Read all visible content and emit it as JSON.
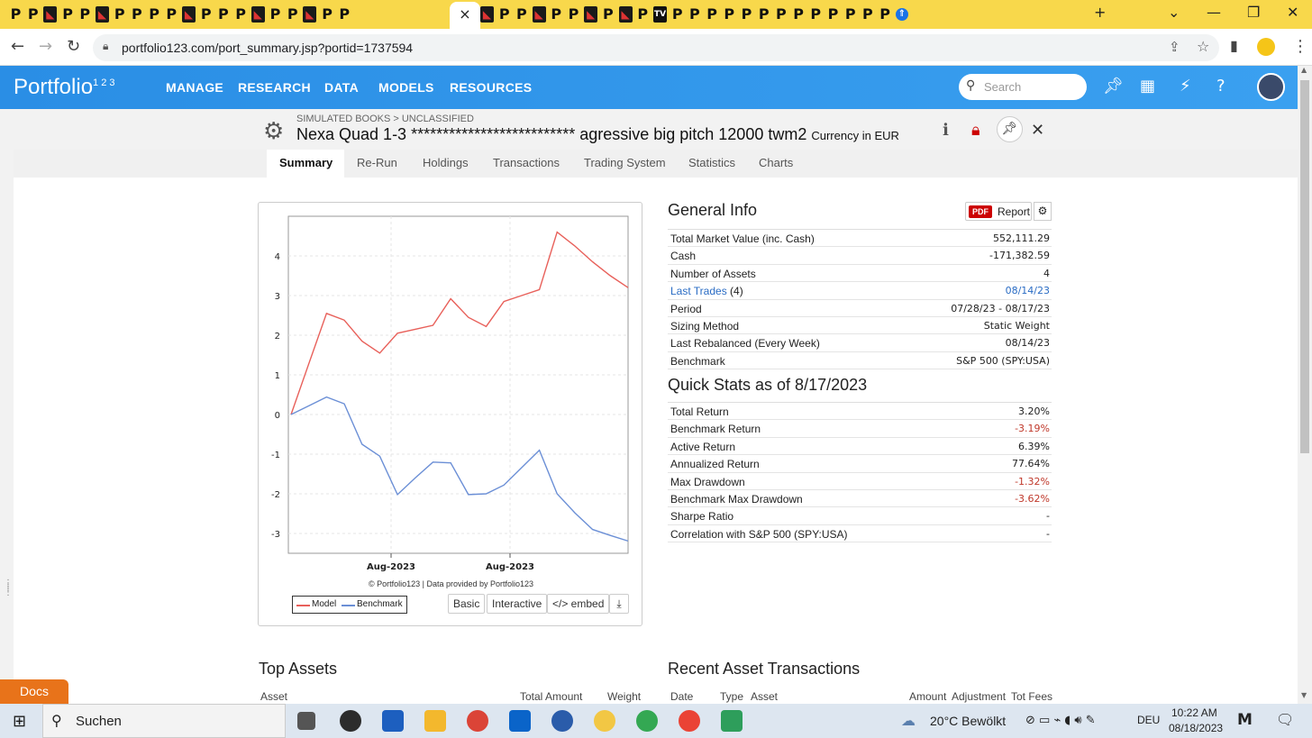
{
  "browser": {
    "url": "portfolio123.com/port_summary.jsp?portid=1737594",
    "active_tab_close": "×",
    "new_tab": "+"
  },
  "site": {
    "logo_text": "Portfolio",
    "logo_sup": "1 2 3",
    "nav": [
      "MANAGE",
      "RESEARCH",
      "DATA",
      "MODELS",
      "RESOURCES"
    ],
    "search_placeholder": "Search"
  },
  "page": {
    "breadcrumb": "SIMULATED BOOKS > UNCLASSIFIED",
    "title": "Nexa Quad 1-3 ************************** agressive big pitch 12000 twm2",
    "currency": "Currency in EUR",
    "tabs": [
      "Summary",
      "Re-Run",
      "Holdings",
      "Transactions",
      "Trading System",
      "Statistics",
      "Charts"
    ],
    "active_tab": "Summary"
  },
  "chart_controls": {
    "copyright": "© Portfolio123 | Data provided by Portfolio123",
    "basic": "Basic",
    "interactive": "Interactive",
    "embed": "</> embed"
  },
  "chart_data": {
    "type": "line",
    "x_tick_labels": [
      "Aug-2023",
      "Aug-2023"
    ],
    "ylim": [
      -3.5,
      5
    ],
    "y_ticks": [
      4,
      3,
      2,
      1,
      0,
      -1,
      -2,
      -3
    ],
    "grid": true,
    "legend_placement": "bottom-left",
    "series": [
      {
        "name": "Model",
        "color": "#e8605a",
        "x": [
          0,
          1,
          2,
          3,
          4,
          5,
          6,
          7,
          8,
          9,
          10,
          11,
          12,
          13,
          14,
          15,
          16,
          17,
          18,
          19
        ],
        "values": [
          0.0,
          1.28,
          2.55,
          2.38,
          1.85,
          1.55,
          2.05,
          2.15,
          2.25,
          2.92,
          2.45,
          2.22,
          2.85,
          3.0,
          3.15,
          4.6,
          4.25,
          3.85,
          3.5,
          3.2
        ]
      },
      {
        "name": "Benchmark",
        "color": "#6b8fd6",
        "x": [
          0,
          1,
          2,
          3,
          4,
          5,
          6,
          7,
          8,
          9,
          10,
          11,
          12,
          13,
          14,
          15,
          16,
          17,
          18,
          19
        ],
        "values": [
          0.0,
          0.22,
          0.44,
          0.27,
          -0.75,
          -1.05,
          -2.02,
          -1.6,
          -1.2,
          -1.22,
          -2.02,
          -2.0,
          -1.78,
          -1.34,
          -0.9,
          -2.0,
          -2.48,
          -2.9,
          -3.05,
          -3.19
        ]
      }
    ]
  },
  "general_info": {
    "title": "General Info",
    "report_badge": "PDF",
    "report_label": "Report",
    "rows": [
      {
        "k": "Total Market Value (inc. Cash)",
        "v": "552,111.29"
      },
      {
        "k": "Cash",
        "v": "-171,382.59"
      },
      {
        "k": "Number of Assets",
        "v": "4"
      },
      {
        "k": "Last Trades",
        "k2": "(4)",
        "v": "08/14/23"
      },
      {
        "k": "Period",
        "v": "07/28/23 - 08/17/23"
      },
      {
        "k": "Sizing Method",
        "v": "Static Weight"
      },
      {
        "k": "Last Rebalanced (Every Week)",
        "v": "08/14/23"
      },
      {
        "k": "Benchmark",
        "v": "S&P 500 (SPY:USA)"
      }
    ]
  },
  "quick_stats": {
    "title": "Quick Stats as of 8/17/2023",
    "rows": [
      {
        "k": "Total Return",
        "v": "3.20%"
      },
      {
        "k": "Benchmark Return",
        "v": "-3.19%"
      },
      {
        "k": "Active Return",
        "v": "6.39%"
      },
      {
        "k": "Annualized Return",
        "v": "77.64%"
      },
      {
        "k": "Max Drawdown",
        "v": "-1.32%"
      },
      {
        "k": "Benchmark Max Drawdown",
        "v": "-3.62%"
      },
      {
        "k": "Sharpe Ratio",
        "v": "-"
      },
      {
        "k": "Correlation with S&P 500 (SPY:USA)",
        "v": "-"
      }
    ]
  },
  "top_assets": {
    "title": "Top Assets",
    "cols": [
      "Asset",
      "Total Amount",
      "Weight"
    ]
  },
  "recent_tx": {
    "title": "Recent Asset Transactions",
    "cols": [
      "Date",
      "Type",
      "Asset",
      "Amount",
      "Adjustment",
      "Tot Fees"
    ]
  },
  "docs": "Docs",
  "taskbar": {
    "search": "Suchen",
    "weather": "20°C  Bewölkt",
    "lang": "DEU",
    "time": "10:22 AM",
    "date": "08/18/2023"
  }
}
